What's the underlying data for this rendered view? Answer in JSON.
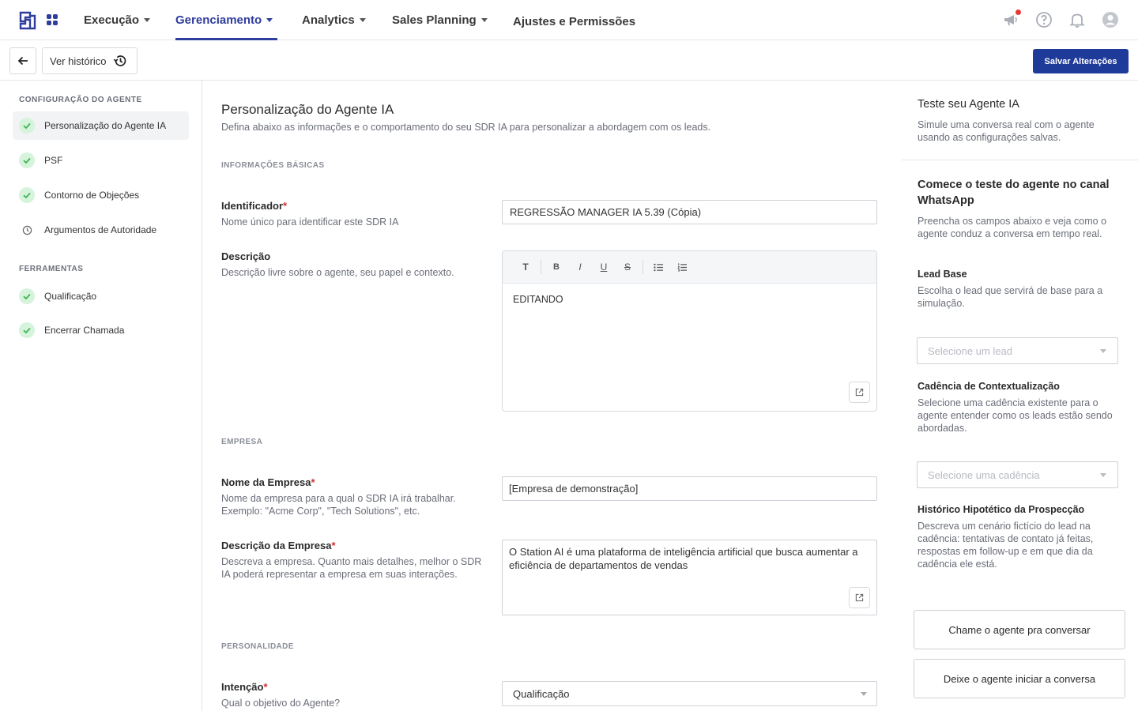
{
  "nav": {
    "items": [
      {
        "label": "Execução",
        "dropdown": true
      },
      {
        "label": "Gerenciamento",
        "dropdown": true,
        "active": true
      },
      {
        "label": "Analytics",
        "dropdown": true
      },
      {
        "label": "Sales Planning",
        "dropdown": true
      },
      {
        "label": "Ajustes e Permissões",
        "dropdown": false
      }
    ],
    "icons": [
      "megaphone-icon",
      "help-icon",
      "bell-icon",
      "user-avatar-icon"
    ],
    "accent": "#2f3d9c"
  },
  "toolbar": {
    "history_label": "Ver histórico",
    "save_label": "Salvar Alterações",
    "save_color": "#1f3b9a"
  },
  "sidebar": {
    "section_config": "CONFIGURAÇÃO DO AGENTE",
    "config_items": [
      {
        "label": "Personalização do Agente IA",
        "status": "done",
        "active": true
      },
      {
        "label": "PSF",
        "status": "done"
      },
      {
        "label": "Contorno de Objeções",
        "status": "done"
      },
      {
        "label": "Argumentos de Autoridade",
        "status": "pending"
      }
    ],
    "section_tools": "FERRAMENTAS",
    "tool_items": [
      {
        "label": "Qualificação",
        "status": "done"
      },
      {
        "label": "Encerrar Chamada",
        "status": "done"
      }
    ]
  },
  "main": {
    "title": "Personalização do Agente IA",
    "subtitle": "Defina abaixo as informações e o comportamento do seu SDR IA para personalizar a abordagem com os leads.",
    "section_basic": "INFORMAÇÕES BÁSICAS",
    "identificador": {
      "label": "Identificador",
      "required": "*",
      "desc": "Nome único para identificar este SDR IA",
      "value": "REGRESSÃO MANAGER IA 5.39 (Cópia)"
    },
    "descricao": {
      "label": "Descrição",
      "desc": "Descrição livre sobre o agente, seu papel e contexto.",
      "value": "EDITANDO",
      "toolbar": [
        "T",
        "B",
        "I",
        "U",
        "S"
      ]
    },
    "section_company": "EMPRESA",
    "nome_empresa": {
      "label": "Nome da Empresa",
      "required": "*",
      "desc": "Nome da empresa para a qual o SDR IA irá trabalhar. Exemplo: \"Acme Corp\", \"Tech Solutions\", etc.",
      "value": "[Empresa de demonstração]"
    },
    "descricao_empresa": {
      "label": "Descrição da Empresa",
      "required": "*",
      "desc": "Descreva a empresa. Quanto mais detalhes, melhor o SDR IA poderá representar a empresa em suas interações.",
      "value": "O Station AI é uma plataforma de inteligência artificial que busca aumentar a eficiência de departamentos de vendas"
    },
    "section_personality": "PERSONALIDADE",
    "intencao": {
      "label": "Intenção",
      "required": "*",
      "desc": "Qual o objetivo do Agente?",
      "value": "Qualificação"
    }
  },
  "test_panel": {
    "title": "Teste seu Agente IA",
    "subtitle": "Simule uma conversa real com o agente usando as configurações salvas.",
    "heading": "Comece o teste do agente no canal WhatsApp",
    "heading_sub": "Preencha os campos abaixo e veja como o agente conduz a conversa em tempo real.",
    "lead_label": "Lead Base",
    "lead_desc": "Escolha o lead que servirá de base para a simulação.",
    "lead_placeholder": "Selecione um lead",
    "cadence_label": "Cadência de Contextualização",
    "cadence_desc": "Selecione uma cadência existente para o agente entender como os leads estão sendo abordadas.",
    "cadence_placeholder": "Selecione uma cadência",
    "history_label": "Histórico Hipotético da Prospecção",
    "history_desc": "Descreva um cenário fictício do lead na cadência: tentativas de contato já feitas, respostas em follow-up e em que dia da cadência ele está.",
    "btn_call_agent": "Chame o agente pra conversar",
    "btn_agent_starts": "Deixe o agente iniciar a conversa"
  }
}
